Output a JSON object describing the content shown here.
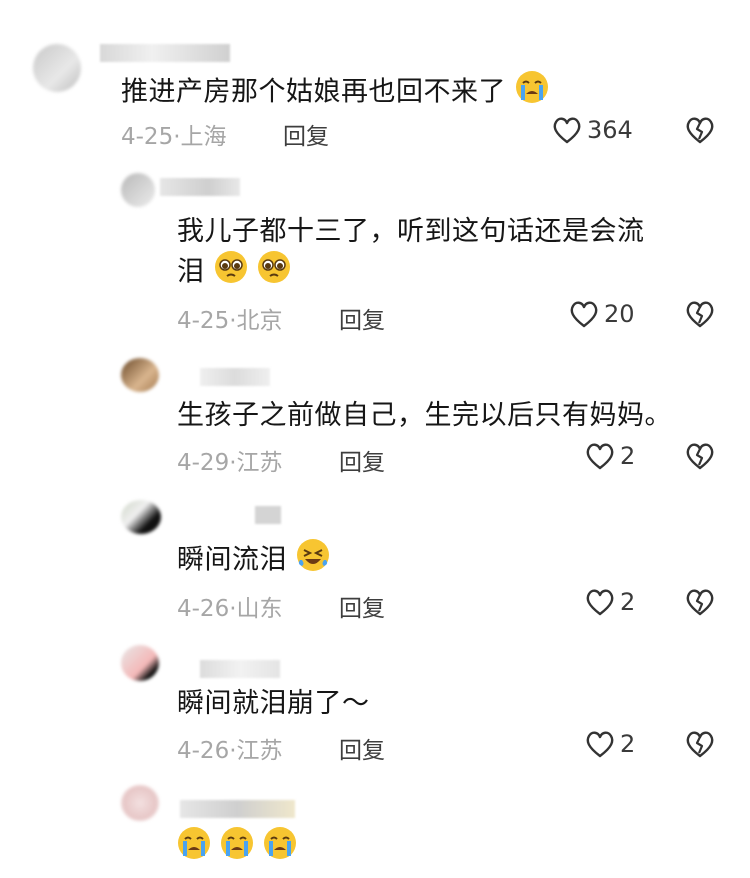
{
  "comments": [
    {
      "text": "推进产房那个姑娘再也回不来了",
      "date": "4-25",
      "location": "上海",
      "reply_label": "回复",
      "likes": "364",
      "emoji": "loudly-crying-face",
      "emoji_count": 1
    },
    {
      "text_line1": "我儿子都十三了，听到这句话还是会流",
      "text_line2": "泪",
      "date": "4-25",
      "location": "北京",
      "reply_label": "回复",
      "likes": "20",
      "emoji": "pleading-face",
      "emoji_count": 2
    },
    {
      "text": "生孩子之前做自己，生完以后只有妈妈。",
      "date": "4-29",
      "location": "江苏",
      "reply_label": "回复",
      "likes": "2"
    },
    {
      "text": "瞬间流泪",
      "date": "4-26",
      "location": "山东",
      "reply_label": "回复",
      "likes": "2",
      "emoji": "rolling-on-floor-laughing",
      "emoji_count": 1
    },
    {
      "text": "瞬间就泪崩了～",
      "date": "4-26",
      "location": "江苏",
      "reply_label": "回复",
      "likes": "2"
    },
    {
      "emoji": "loudly-crying-face",
      "emoji_count": 3
    }
  ],
  "meta_separator": "·",
  "icons": {
    "like": "heart-outline-icon",
    "dislike": "broken-heart-outline-icon"
  },
  "colors": {
    "text": "#161616",
    "meta": "#a6a6a6",
    "reply": "#3e3e3e",
    "emoji_yellow": "#f7c531",
    "tear_blue": "#4aa3f0"
  }
}
